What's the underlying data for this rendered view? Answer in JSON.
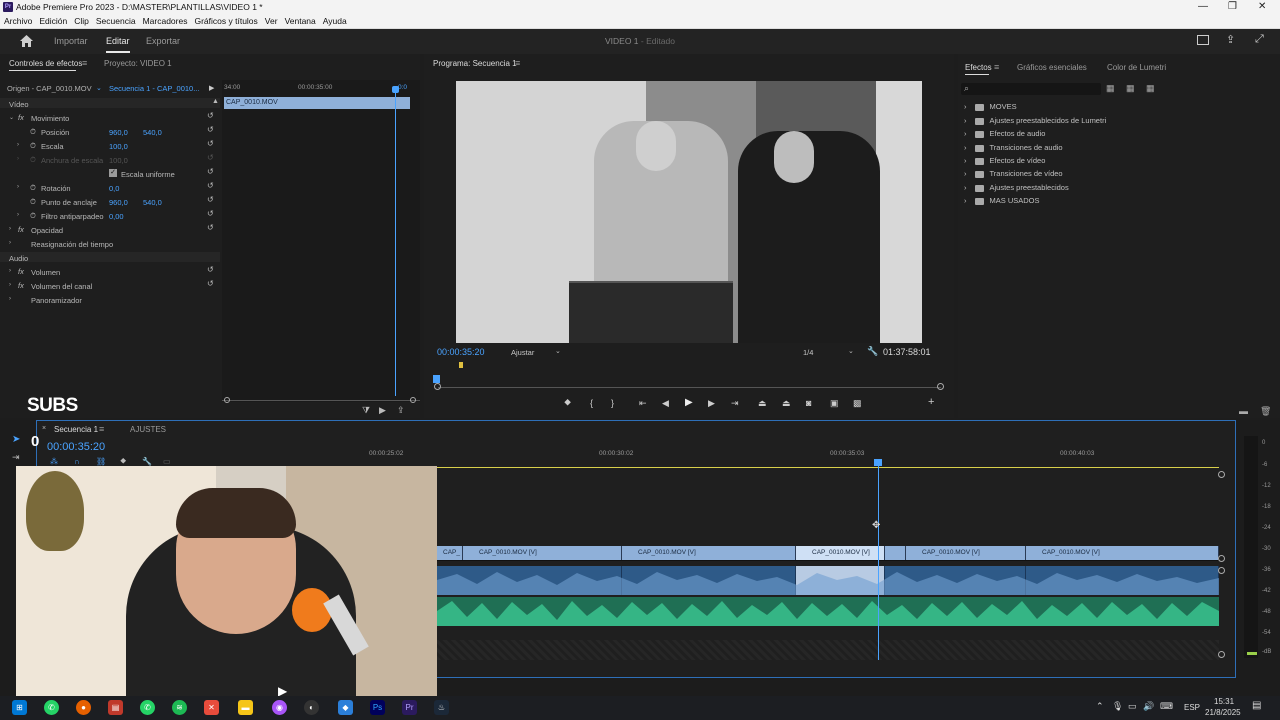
{
  "window": {
    "title": "Adobe Premiere Pro 2023 - D:\\MASTER\\PLANTILLAS\\VIDEO 1 *",
    "app_icon": "Pr"
  },
  "menu": [
    "Archivo",
    "Edición",
    "Clip",
    "Secuencia",
    "Marcadores",
    "Gráficos y títulos",
    "Ver",
    "Ventana",
    "Ayuda"
  ],
  "header": {
    "tabs": [
      "Importar",
      "Editar",
      "Exportar"
    ],
    "active_tab": "Editar",
    "project_title": "VIDEO 1",
    "project_status": "- Editado"
  },
  "effect_controls": {
    "tabs": [
      "Controles de efectos",
      "Proyecto: VIDEO 1"
    ],
    "source": "Origen - CAP_0010.MOV",
    "sequence": "Secuencia 1 - CAP_0010...",
    "timeline_times": [
      "34:00",
      "00:00:35:00",
      "0:0"
    ],
    "clip_label": "CAP_0010.MOV",
    "sections": {
      "video": "Vídeo",
      "movimiento": "Movimiento",
      "posicion": "Posición",
      "posicion_x": "960,0",
      "posicion_y": "540,0",
      "escala": "Escala",
      "escala_val": "100,0",
      "anchura": "Anchura de escala",
      "anchura_val": "100,0",
      "escala_uniforme": "Escala uniforme",
      "rotacion": "Rotación",
      "rotacion_val": "0,0",
      "punto": "Punto de anclaje",
      "punto_x": "960,0",
      "punto_y": "540,0",
      "filtro": "Filtro antiparpadeo",
      "filtro_val": "0,00",
      "opacidad": "Opacidad",
      "reasignacion": "Reasignación del tiempo",
      "audio": "Audio",
      "volumen": "Volumen",
      "volumen_canal": "Volumen del canal",
      "panoramizador": "Panoramizador"
    },
    "overlay_text": "SUBS"
  },
  "program": {
    "title": "Programa: Secuencia 1",
    "timecode": "00:00:35:20",
    "fit": "Ajustar",
    "resolution": "1/4",
    "duration": "01:37:58:01"
  },
  "effects_panel": {
    "tabs": [
      "Efectos",
      "Gráficos esenciales",
      "Color de Lumetri"
    ],
    "items": [
      "MOVES",
      "Ajustes preestablecidos de Lumetri",
      "Efectos de audio",
      "Transiciones de audio",
      "Efectos de vídeo",
      "Transiciones de vídeo",
      "Ajustes preestablecidos",
      "MAS USADOS"
    ]
  },
  "timeline": {
    "tabs": [
      "Secuencia 1",
      "AJUSTES"
    ],
    "timecode": "00:00:35:20",
    "ruler": [
      "00:00:25:02",
      "00:00:30:02",
      "00:00:35:03",
      "00:00:40:03"
    ],
    "clips": [
      "CAP_",
      "CAP_0010.MOV [V]",
      "CAP_0010.MOV [V]",
      "CAP_0010.MOV [V]",
      "CAP_0010.MOV [V]",
      "CAP_0010.MOV [V]"
    ],
    "meter_labels": [
      "0",
      "-6",
      "-12",
      "-18",
      "-24",
      "-30",
      "-36",
      "-42",
      "-48",
      "-54",
      "-dB"
    ]
  },
  "taskbar": {
    "language": "ESP",
    "time": "15:31",
    "date": "21/8/2025"
  },
  "overlay_counter": "0",
  "colors": {
    "accent": "#4aa3ff",
    "clip_video": "#8fb0d9",
    "audio_blue": "#2e5a88",
    "audio_green": "#1f6f54",
    "panel": "#1e1e1e"
  }
}
